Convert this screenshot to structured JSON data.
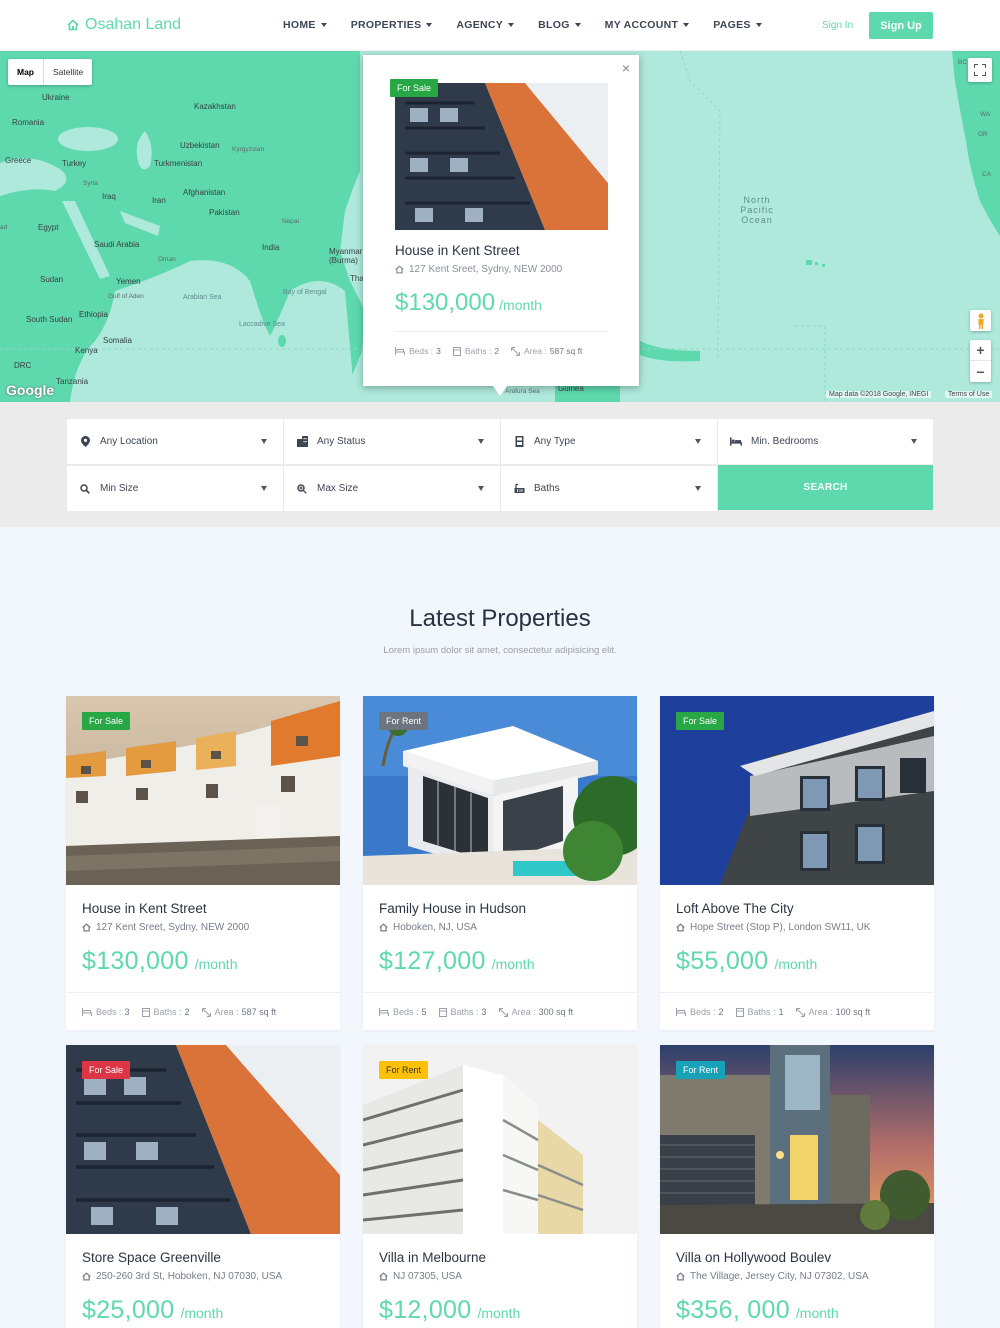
{
  "header": {
    "logo_text": "Osahan Land",
    "nav": [
      "HOME",
      "PROPERTIES",
      "AGENCY",
      "BLOG",
      "MY ACCOUNT",
      "PAGES"
    ],
    "signin_label": "Sign In",
    "signup_label": "Sign Up"
  },
  "map": {
    "type_map": "Map",
    "type_satellite": "Satellite",
    "google_logo": "Google",
    "attribution": "Map data ©2018 Google, INEGI",
    "terms": "Terms of Use",
    "labels": {
      "ukraine": "Ukraine",
      "kazakhstan": "Kazakhstan",
      "romania": "Romania",
      "uzbekistan": "Uzbekistan",
      "kyrgyzstan": "Kyrgyzstan",
      "greece": "Greece",
      "turkey": "Turkey",
      "turkmenistan": "Turkmenistan",
      "syria": "Syria",
      "afghanistan": "Afghanistan",
      "iraq": "Iraq",
      "iran": "Iran",
      "pakistan": "Pakistan",
      "nepal": "Nepal",
      "egypt": "Egypt",
      "saudi_arabia": "Saudi Arabia",
      "india": "India",
      "myanmar": "Myanmar (Burma)",
      "oman": "Oman",
      "yemen": "Yemen",
      "sudan": "Sudan",
      "gulf_aden": "Gulf of Aden",
      "arabian_sea": "Arabian Sea",
      "bay_bengal": "Bay of Bengal",
      "south_sudan": "South Sudan",
      "ethiopia": "Ethiopia",
      "laccadive": "Laccadive Sea",
      "somalia": "Somalia",
      "kenya": "Kenya",
      "drc": "DRC",
      "tanzania": "Tanzania",
      "north_pacific": "North Pacific Ocean",
      "guinea": "Guinea",
      "arafura": "Arafura Sea",
      "bc": "BC",
      "wa": "WA",
      "or": "OR",
      "ca": "CA",
      "ad": "ad",
      "tha": "Tha"
    },
    "popup": {
      "badge": "For Sale",
      "badge_color": "#28a745",
      "title": "House in Kent Street",
      "address": "127 Kent Sreet, Sydny, NEW 2000",
      "price": "$130,000",
      "period": "/month",
      "beds_label": "Beds :",
      "beds": "3",
      "baths_label": "Baths :",
      "baths": "2",
      "area_label": "Area :",
      "area": "587 sq ft"
    }
  },
  "search": {
    "location": "Any Location",
    "status": "Any Status",
    "type": "Any Type",
    "bedrooms": "Min. Bedrooms",
    "min_size": "Min Size",
    "max_size": "Max Size",
    "baths": "Baths",
    "button": "SEARCH"
  },
  "section": {
    "title": "Latest Properties",
    "subtitle": "Lorem ipsum dolor sit amet, consectetur adipisicing elit."
  },
  "labels": {
    "beds": "Beds :",
    "baths": "Baths :",
    "area": "Area :"
  },
  "properties": [
    {
      "badge": "For Sale",
      "badge_color": "#28a745",
      "title": "House in Kent Street",
      "address": "127 Kent Sreet, Sydny, NEW 2000",
      "price": "$130,000",
      "period": "/month",
      "beds": "3",
      "baths": "2",
      "area": "587 sq ft"
    },
    {
      "badge": "For Rent",
      "badge_color": "#6c757d",
      "title": "Family House in Hudson",
      "address": "Hoboken, NJ, USA",
      "price": "$127,000",
      "period": "/month",
      "beds": "5",
      "baths": "3",
      "area": "300 sq ft"
    },
    {
      "badge": "For Sale",
      "badge_color": "#28a745",
      "title": "Loft Above The City",
      "address": "Hope Street (Stop P), London SW11, UK",
      "price": "$55,000",
      "period": "/month",
      "beds": "2",
      "baths": "1",
      "area": "100 sq ft"
    },
    {
      "badge": "For Sale",
      "badge_color": "#dc3545",
      "title": "Store Space Greenville",
      "address": "250-260 3rd St, Hoboken, NJ 07030, USA",
      "price": "$25,000",
      "period": "/month"
    },
    {
      "badge": "For Rent",
      "badge_color": "#ffc107",
      "badge_text_color": "#333333",
      "title": "Villa in Melbourne",
      "address": "NJ 07305, USA",
      "price": "$12,000",
      "period": "/month"
    },
    {
      "badge": "For Rent",
      "badge_color": "#17a2b8",
      "title": "Villa on Hollywood Boulev",
      "address": "The Village, Jersey City, NJ 07302, USA",
      "price": "$356, 000",
      "period": "/month"
    }
  ]
}
